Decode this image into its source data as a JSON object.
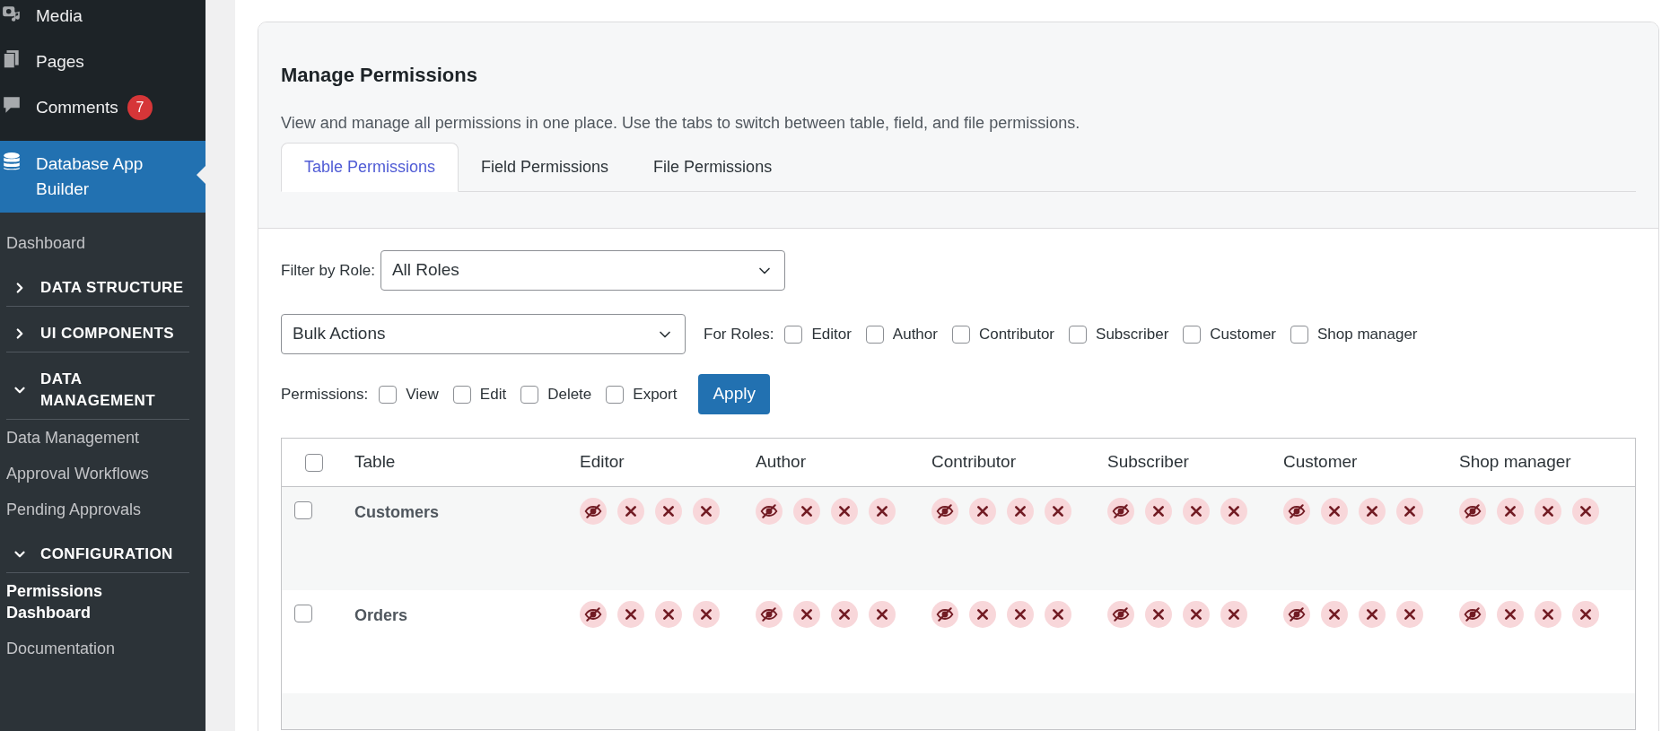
{
  "sidebar": {
    "menu": [
      {
        "label": "Media",
        "kind": "media",
        "selected": false
      },
      {
        "label": "Pages",
        "kind": "pages",
        "selected": false
      },
      {
        "label": "Comments",
        "kind": "comments",
        "badge": "7",
        "selected": false
      },
      {
        "label": "Database App Builder",
        "kind": "database",
        "selected": true
      }
    ],
    "submenu": [
      {
        "kind": "link",
        "label": "Dashboard",
        "selected": false
      },
      {
        "kind": "section",
        "label": "DATA STRUCTURE",
        "expanded": false
      },
      {
        "kind": "section",
        "label": "UI COMPONENTS",
        "expanded": false
      },
      {
        "kind": "section",
        "label": "DATA MANAGEMENT",
        "expanded": true
      },
      {
        "kind": "link",
        "label": "Data Management",
        "selected": false
      },
      {
        "kind": "link",
        "label": "Approval Workflows",
        "selected": false
      },
      {
        "kind": "link",
        "label": "Pending Approvals",
        "selected": false
      },
      {
        "kind": "section",
        "label": "CONFIGURATION",
        "expanded": true
      },
      {
        "kind": "link",
        "label": "Permissions Dashboard",
        "selected": true
      },
      {
        "kind": "link",
        "label": "Documentation",
        "selected": false
      }
    ]
  },
  "panel": {
    "title": "Manage Permissions",
    "description": "View and manage all permissions in one place. Use the tabs to switch between table, field, and file permissions.",
    "tabs": [
      {
        "label": "Table Permissions",
        "selected": true
      },
      {
        "label": "Field Permissions",
        "selected": false
      },
      {
        "label": "File Permissions",
        "selected": false
      }
    ]
  },
  "filter": {
    "label": "Filter by Role:",
    "value": "All Roles"
  },
  "bulk": {
    "value": "Bulk Actions",
    "roles_label": "For Roles:",
    "roles": [
      {
        "label": "Editor",
        "checked": false
      },
      {
        "label": "Author",
        "checked": false
      },
      {
        "label": "Contributor",
        "checked": false
      },
      {
        "label": "Subscriber",
        "checked": false
      },
      {
        "label": "Customer",
        "checked": false
      },
      {
        "label": "Shop manager",
        "checked": false
      }
    ],
    "permissions_label": "Permissions:",
    "permissions": [
      {
        "label": "View",
        "checked": false
      },
      {
        "label": "Edit",
        "checked": false
      },
      {
        "label": "Delete",
        "checked": false
      },
      {
        "label": "Export",
        "checked": false
      }
    ],
    "apply": "Apply"
  },
  "table": {
    "select_all": false,
    "columns": [
      "Table",
      "Editor",
      "Author",
      "Contributor",
      "Subscriber",
      "Customer",
      "Shop manager"
    ],
    "rows": [
      {
        "name": "Customers",
        "selected": false,
        "cells": [
          {
            "view": false,
            "edit": false,
            "delete": false,
            "export": false
          },
          {
            "view": false,
            "edit": false,
            "delete": false,
            "export": false
          },
          {
            "view": false,
            "edit": false,
            "delete": false,
            "export": false
          },
          {
            "view": false,
            "edit": false,
            "delete": false,
            "export": false
          },
          {
            "view": false,
            "edit": false,
            "delete": false,
            "export": false
          },
          {
            "view": false,
            "edit": false,
            "delete": false,
            "export": false
          }
        ]
      },
      {
        "name": "Orders",
        "selected": false,
        "cells": [
          {
            "view": false,
            "edit": false,
            "delete": false,
            "export": false
          },
          {
            "view": false,
            "edit": false,
            "delete": false,
            "export": false
          },
          {
            "view": false,
            "edit": false,
            "delete": false,
            "export": false
          },
          {
            "view": false,
            "edit": false,
            "delete": false,
            "export": false
          },
          {
            "view": false,
            "edit": false,
            "delete": false,
            "export": false
          },
          {
            "view": false,
            "edit": false,
            "delete": false,
            "export": false
          }
        ]
      }
    ]
  }
}
